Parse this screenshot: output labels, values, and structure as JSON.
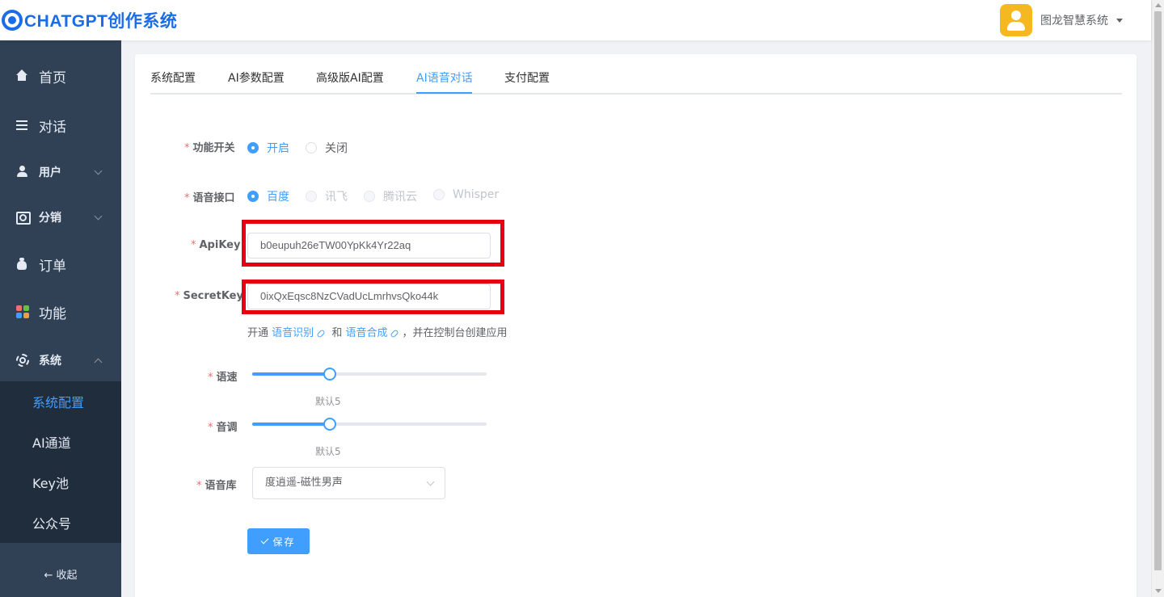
{
  "header": {
    "logo_text": "CHATGPT创作系统",
    "user_name": "图龙智慧系统"
  },
  "sidebar": {
    "items": [
      {
        "label": "首页",
        "icon": "home-icon"
      },
      {
        "label": "对话",
        "icon": "menu-icon"
      },
      {
        "label": "用户",
        "icon": "user-icon",
        "expandable": true
      },
      {
        "label": "分销",
        "icon": "distribution-icon",
        "expandable": true
      },
      {
        "label": "订单",
        "icon": "money-bag-icon"
      },
      {
        "label": "功能",
        "icon": "grid-icon"
      },
      {
        "label": "系统",
        "icon": "gear-icon",
        "expanded": true
      }
    ],
    "submenu": [
      {
        "label": "系统配置",
        "active": true
      },
      {
        "label": "AI通道"
      },
      {
        "label": "Key池"
      },
      {
        "label": "公众号"
      }
    ],
    "collapse_label": "← 收起"
  },
  "tabs": [
    {
      "label": "系统配置"
    },
    {
      "label": "AI参数配置"
    },
    {
      "label": "高级版AI配置"
    },
    {
      "label": "AI语音对话",
      "active": true
    },
    {
      "label": "支付配置"
    }
  ],
  "form": {
    "required_mark": "*",
    "switch": {
      "label": "功能开关",
      "options": [
        {
          "label": "开启",
          "checked": true
        },
        {
          "label": "关闭"
        }
      ]
    },
    "api": {
      "label": "语音接口",
      "options": [
        {
          "label": "百度",
          "checked": true
        },
        {
          "label": "讯飞",
          "disabled": true
        },
        {
          "label": "腾讯云",
          "disabled": true
        },
        {
          "label": "Whisper",
          "disabled": true
        }
      ]
    },
    "apikey": {
      "label": "ApiKey",
      "value": "b0eupuh26eTW00YpKk4Yr22aq"
    },
    "secretkey": {
      "label": "SecretKey",
      "value": "0ixQxEqsc8NzCVadUcLmrhvsQko44k"
    },
    "hint": {
      "prefix": "开通",
      "link1": "语音识别",
      "middle": "和",
      "link2": "语音合成",
      "suffix": "，并在控制台创建应用"
    },
    "speed": {
      "label": "语速",
      "hint": "默认5",
      "fraction": 0.33
    },
    "tone": {
      "label": "音调",
      "hint": "默认5",
      "fraction": 0.33
    },
    "voice": {
      "label": "语音库",
      "value": "度逍遥-磁性男声"
    },
    "save_label": "保存"
  },
  "colors": {
    "primary": "#409eff",
    "sidebar_bg": "#304156",
    "highlight_box": "#e60012",
    "avatar": "#f5b820"
  }
}
